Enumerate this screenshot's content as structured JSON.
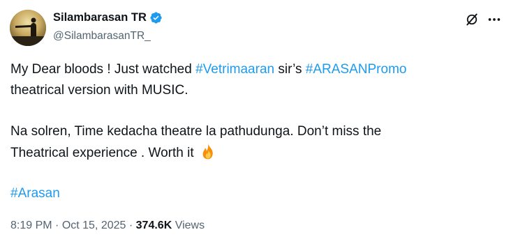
{
  "author": {
    "display_name": "Silambarasan TR",
    "handle": "@SilambarasanTR_",
    "verified": true,
    "verified_color": "#1d9bf0"
  },
  "actions": {
    "grok_icon": "grok-icon",
    "more_icon": "more-icon"
  },
  "tweet": {
    "line1_pre": "My Dear bloods ! Just watched ",
    "hashtag1": "#Vetrimaaran",
    "line1_mid": " sir’s ",
    "hashtag2": "#ARASANPromo",
    "line2": "theatrical version with MUSIC.",
    "line3": "Na solren, Time kedacha theatre la pathudunga. Don’t miss the",
    "line4": "Theatrical experience . Worth it",
    "emoji": "fire-emoji",
    "hashtag3": "#Arasan"
  },
  "meta": {
    "time": "8:19 PM",
    "sep1": " · ",
    "date": "Oct 15, 2025",
    "sep2": " · ",
    "views_count": "374.6K",
    "views_label": " Views"
  },
  "colors": {
    "link": "#1d9bf0",
    "text": "#0f1419",
    "secondary": "#536471"
  }
}
